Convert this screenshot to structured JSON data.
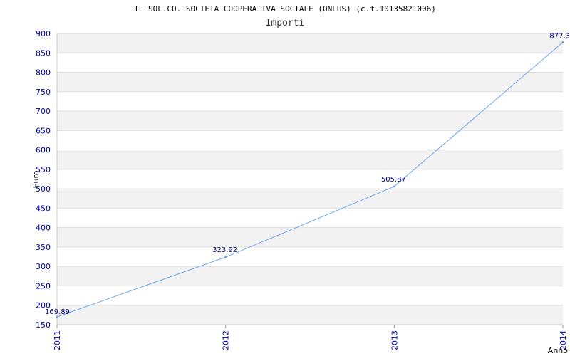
{
  "chart_data": {
    "type": "line",
    "title": "IL SOL.CO. SOCIETA COOPERATIVA SOCIALE (ONLUS) (c.f.10135821006)",
    "subtitle": "Importi",
    "xlabel": "Anno",
    "ylabel": "Euro",
    "categories": [
      "2011",
      "2012",
      "2013",
      "2014"
    ],
    "series": [
      {
        "values": [
          169.89,
          323.92,
          505.87,
          877.3
        ]
      }
    ],
    "data_labels": [
      "169.89",
      "323.92",
      "505.87",
      "877.3"
    ],
    "yticks": [
      "150",
      "200",
      "250",
      "300",
      "350",
      "400",
      "450",
      "500",
      "550",
      "600",
      "650",
      "700",
      "750",
      "800",
      "850",
      "900"
    ],
    "ylim": [
      150,
      900
    ],
    "grid": "horizontal alternating bands",
    "colors": {
      "line": "#6aa6e8",
      "band": "#f2f2f2",
      "grid": "#dddddd",
      "tick": "#0000aa"
    }
  }
}
